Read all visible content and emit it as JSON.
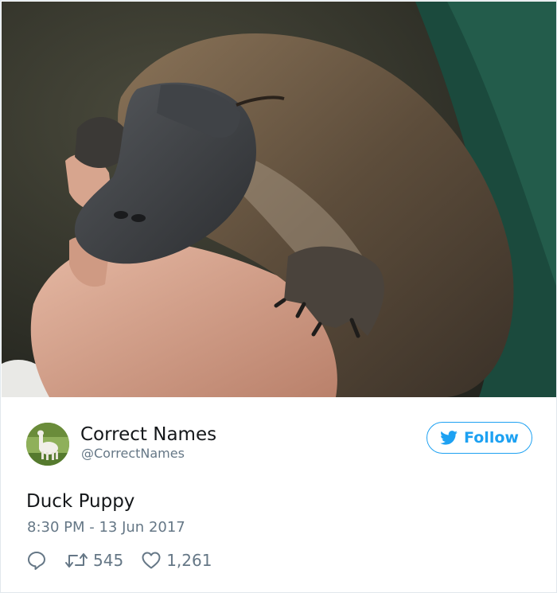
{
  "photo": {
    "alt": "platypus held in hands",
    "palette": {
      "background": "#2f3028",
      "sleeve": "#1d4a3c",
      "fur": "#6b5a45",
      "bill": "#3a3c40",
      "skin": "#d9a892"
    }
  },
  "user": {
    "display_name": "Correct Names",
    "handle": "@CorrectNames",
    "avatar_icon": "alpaca-avatar"
  },
  "follow": {
    "label": "Follow",
    "icon": "twitter-bird-icon",
    "color": "#1da1f2"
  },
  "tweet": {
    "text": "Duck Puppy",
    "timestamp": "8:30 PM - 13 Jun 2017"
  },
  "actions": {
    "reply_icon": "reply-icon",
    "retweet_icon": "retweet-icon",
    "retweet_count": "545",
    "like_icon": "heart-icon",
    "like_count": "1,261"
  },
  "colors": {
    "text_primary": "#14171a",
    "text_secondary": "#657786",
    "accent": "#1da1f2",
    "border": "#e1e8ed"
  }
}
